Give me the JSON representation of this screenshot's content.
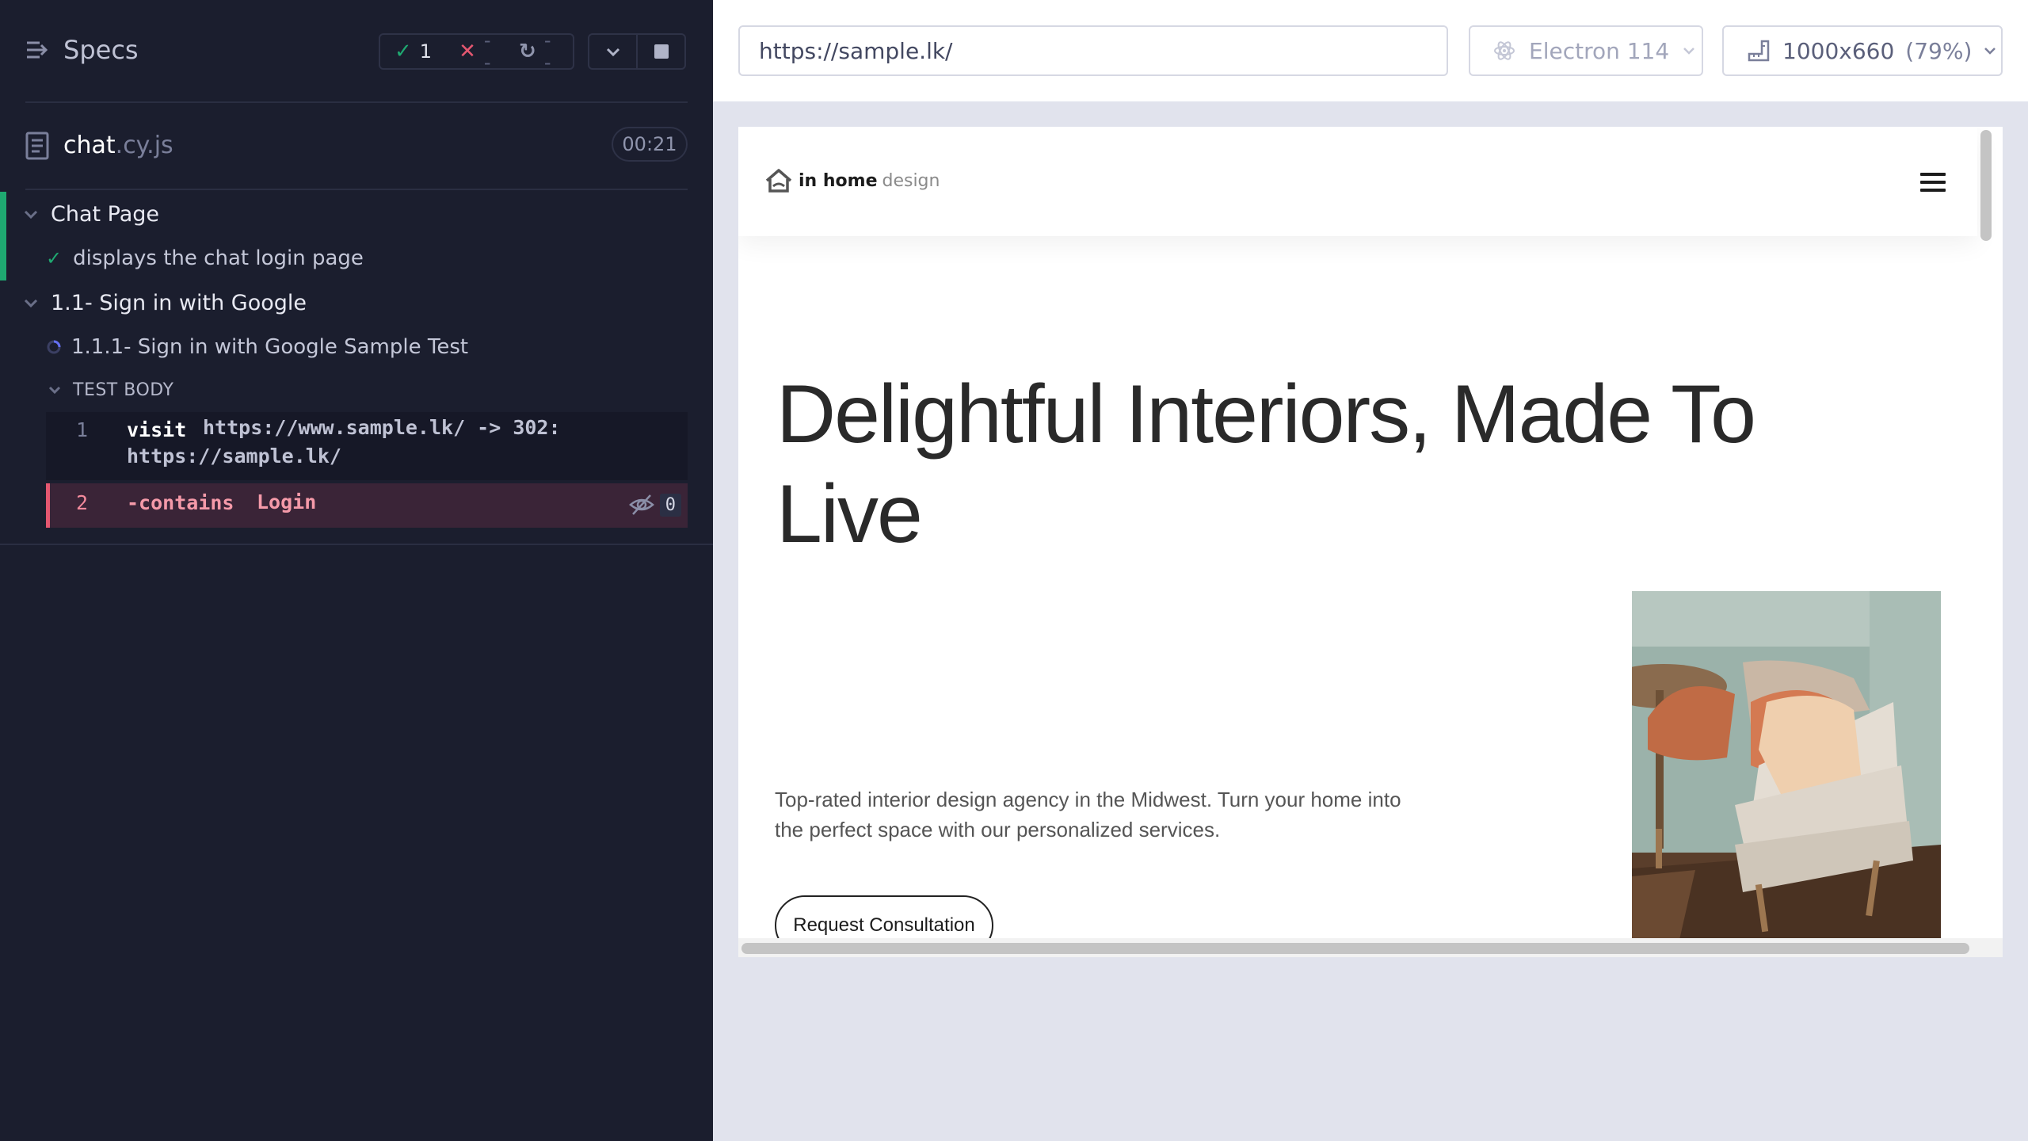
{
  "reporter": {
    "specs_label": "Specs",
    "stats": {
      "passed": "1",
      "failed": "--",
      "pending": "--"
    },
    "spec": {
      "name": "chat",
      "ext": ".cy.js",
      "duration": "00:21"
    },
    "suites": [
      {
        "title": "Chat Page",
        "tests": [
          {
            "title": "displays the chat login page",
            "state": "passed"
          }
        ]
      },
      {
        "title": "1.1- Sign in with Google",
        "tests": [
          {
            "title": "1.1.1- Sign in with Google Sample Test",
            "state": "running"
          }
        ]
      }
    ],
    "hook_title": "TEST BODY",
    "commands": [
      {
        "num": "1",
        "name": "visit",
        "message": "https://www.sample.lk/ -> 302:",
        "message2": "https://sample.lk/"
      },
      {
        "num": "2",
        "name": "-contains",
        "message": "Login",
        "visible_count": "0"
      }
    ],
    "colors": {
      "pass": "#1fa971",
      "fail": "#e45770",
      "bg": "#1b1e2e"
    }
  },
  "aut": {
    "url": "https://sample.lk/",
    "browser": "Electron 114",
    "viewport": "1000x660",
    "viewport_scale": "(79%)"
  },
  "site": {
    "logo_in": "in home",
    "logo_design": "design",
    "hero_title": "Delightful Interiors, Made To Live",
    "hero_text": "Top-rated interior design agency in the Midwest. Turn your home into the perfect space with our personalized services.",
    "cta": "Request Consultation"
  }
}
